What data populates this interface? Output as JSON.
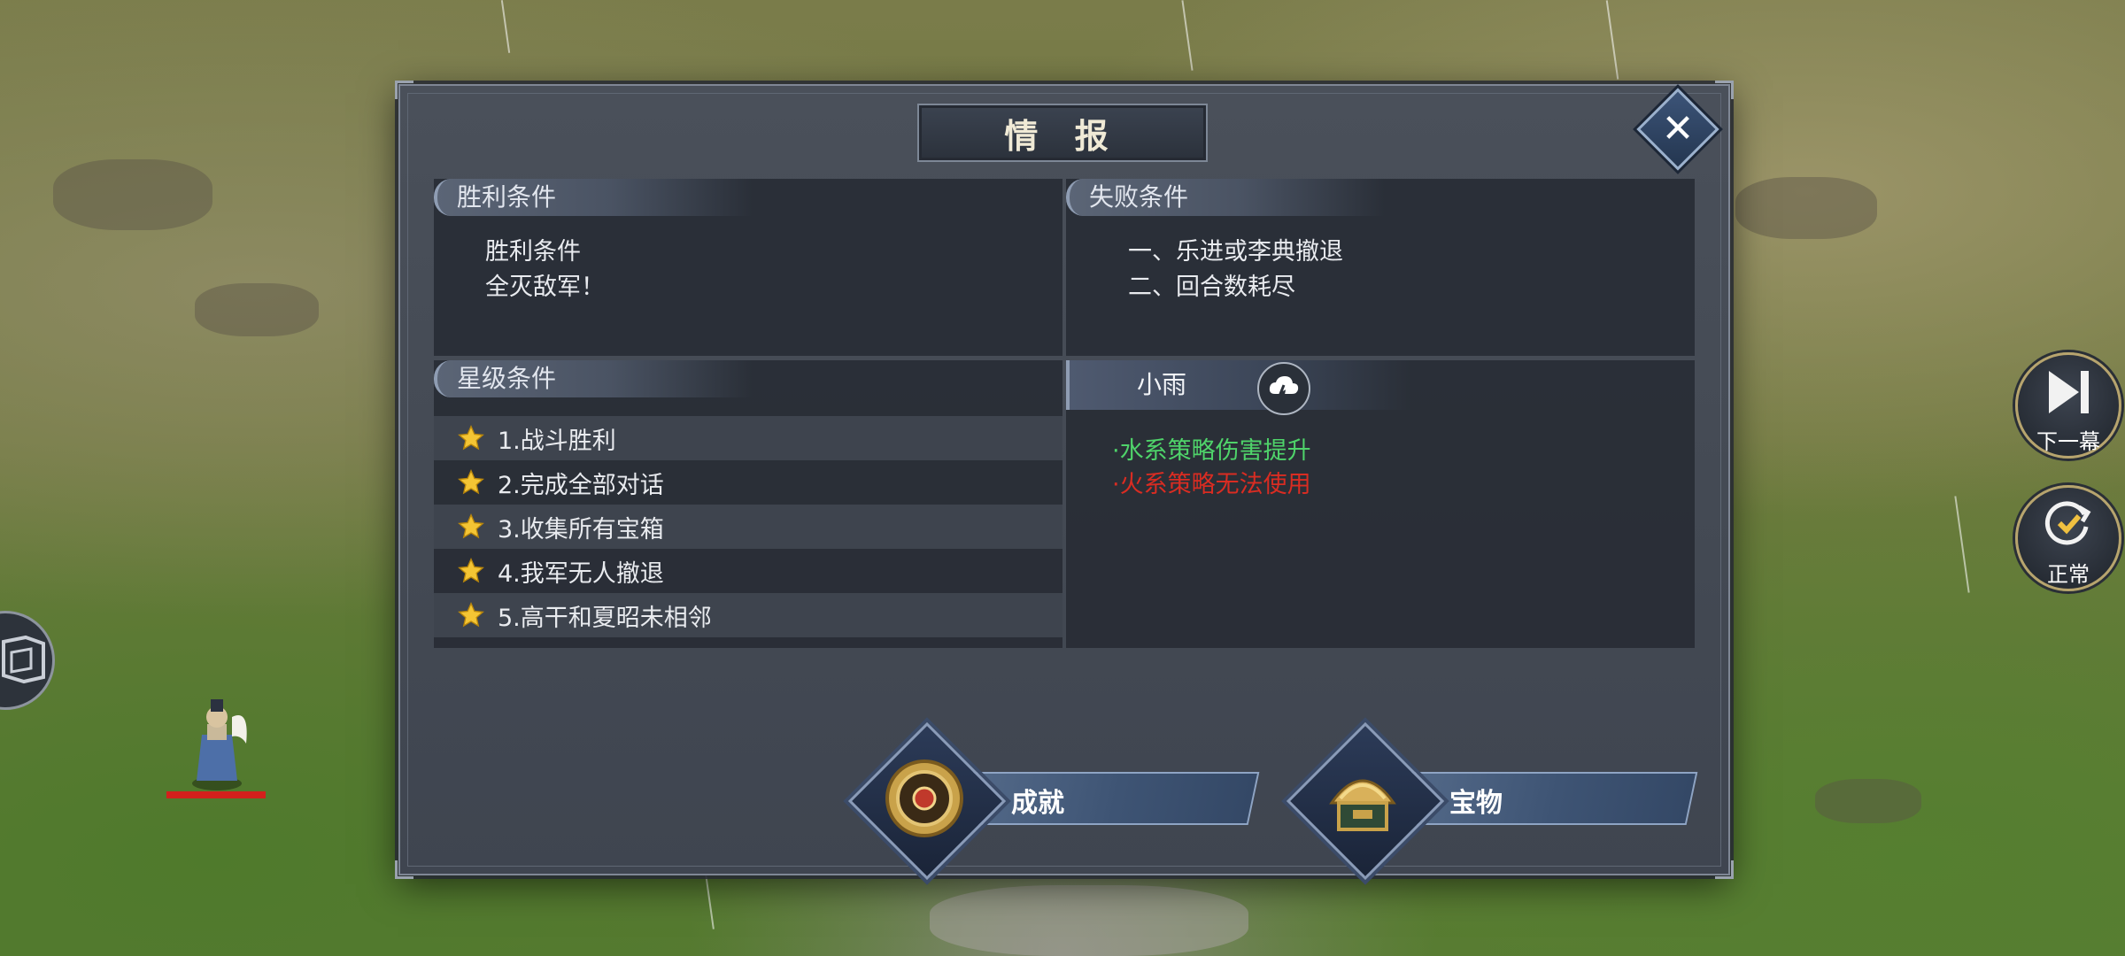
{
  "dialog": {
    "title": "情 报",
    "close_icon": "close-icon"
  },
  "victory": {
    "header": "胜利条件",
    "lines": [
      "胜利条件",
      "全灭敌军！"
    ]
  },
  "defeat": {
    "header": "失败条件",
    "lines": [
      "一、乐进或李典撤退",
      "二、回合数耗尽"
    ]
  },
  "stars": {
    "header": "星级条件",
    "items": [
      "1.战斗胜利",
      "2.完成全部对话",
      "3.收集所有宝箱",
      "4.我军无人撤退",
      "5.高干和夏昭未相邻"
    ]
  },
  "weather": {
    "name": "小雨",
    "icon": "rain-cloud-icon",
    "effects": [
      {
        "text": "·水系策略伤害提升",
        "color": "#4fd36a"
      },
      {
        "text": "·火系策略无法使用",
        "color": "#d92c22"
      }
    ]
  },
  "actions": {
    "achievement_label": "成就",
    "treasure_label": "宝物"
  },
  "side_buttons": {
    "next_label": "下一幕",
    "speed_label": "正常"
  },
  "colors": {
    "accent": "#8ea4c4",
    "star": "#f4c534",
    "health": "#d3201c"
  }
}
